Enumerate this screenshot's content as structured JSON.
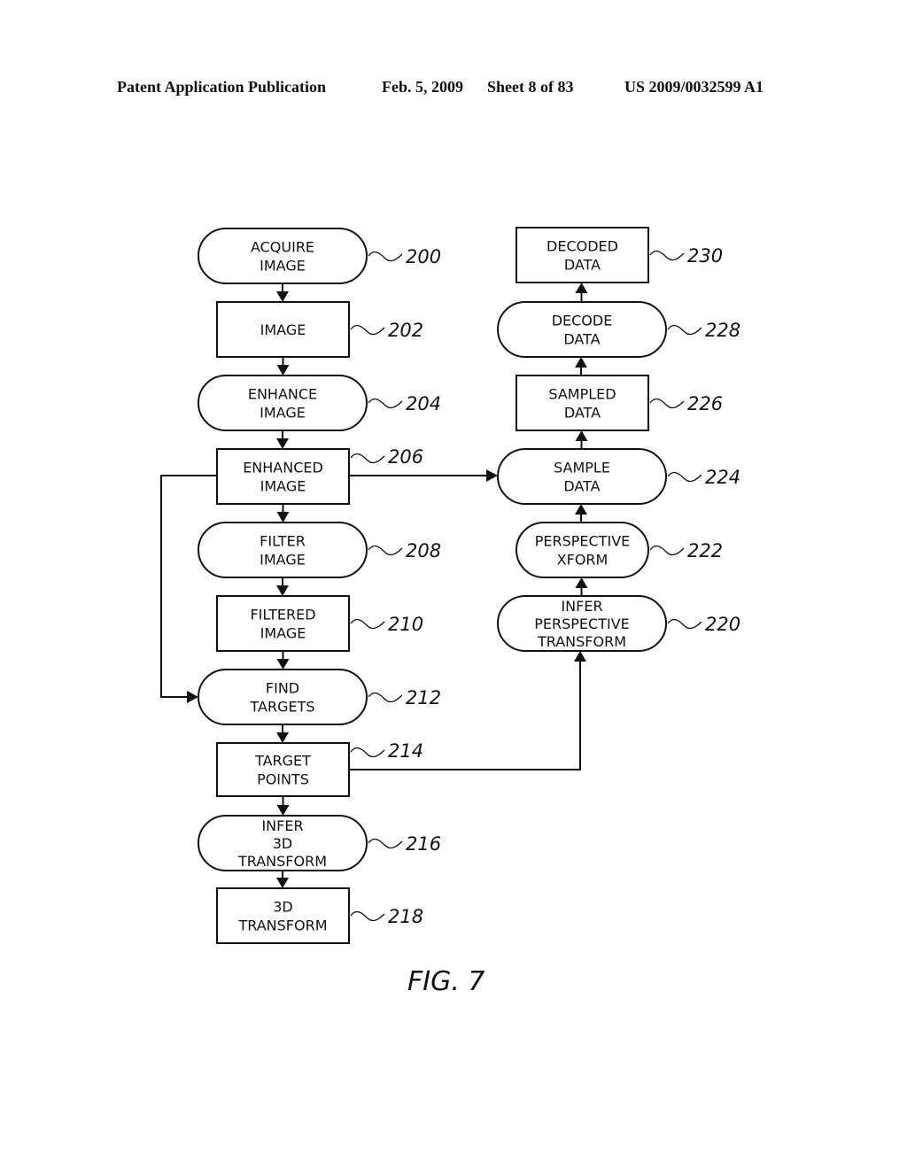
{
  "header": {
    "publication": "Patent Application Publication",
    "date": "Feb. 5, 2009",
    "sheet": "Sheet 8 of 83",
    "number": "US 2009/0032599 A1"
  },
  "figure": {
    "label": "FIG. 7",
    "nodes": [
      {
        "id": "200",
        "ref": "200",
        "shape": "rounded",
        "lines": [
          "ACQUIRE",
          "IMAGE"
        ]
      },
      {
        "id": "202",
        "ref": "202",
        "shape": "rect",
        "lines": [
          "IMAGE"
        ]
      },
      {
        "id": "204",
        "ref": "204",
        "shape": "rounded",
        "lines": [
          "ENHANCE",
          "IMAGE"
        ]
      },
      {
        "id": "206",
        "ref": "206",
        "shape": "rect",
        "lines": [
          "ENHANCED",
          "IMAGE"
        ]
      },
      {
        "id": "208",
        "ref": "208",
        "shape": "rounded",
        "lines": [
          "FILTER",
          "IMAGE"
        ]
      },
      {
        "id": "210",
        "ref": "210",
        "shape": "rect",
        "lines": [
          "FILTERED",
          "IMAGE"
        ]
      },
      {
        "id": "212",
        "ref": "212",
        "shape": "rounded",
        "lines": [
          "FIND",
          "TARGETS"
        ]
      },
      {
        "id": "214",
        "ref": "214",
        "shape": "rect",
        "lines": [
          "TARGET",
          "POINTS"
        ]
      },
      {
        "id": "216",
        "ref": "216",
        "shape": "rounded",
        "lines": [
          "INFER",
          "3D",
          "TRANSFORM"
        ]
      },
      {
        "id": "218",
        "ref": "218",
        "shape": "rect",
        "lines": [
          "3D",
          "TRANSFORM"
        ]
      },
      {
        "id": "220",
        "ref": "220",
        "shape": "rounded",
        "lines": [
          "INFER",
          "PERSPECTIVE",
          "TRANSFORM"
        ]
      },
      {
        "id": "222",
        "ref": "222",
        "shape": "rounded",
        "lines": [
          "PERSPECTIVE",
          "XFORM"
        ]
      },
      {
        "id": "224",
        "ref": "224",
        "shape": "rounded",
        "lines": [
          "SAMPLE",
          "DATA"
        ]
      },
      {
        "id": "226",
        "ref": "226",
        "shape": "rect",
        "lines": [
          "SAMPLED",
          "DATA"
        ]
      },
      {
        "id": "228",
        "ref": "228",
        "shape": "rounded",
        "lines": [
          "DECODE",
          "DATA"
        ]
      },
      {
        "id": "230",
        "ref": "230",
        "shape": "rect",
        "lines": [
          "DECODED",
          "DATA"
        ]
      }
    ],
    "edges": [
      {
        "from": "200",
        "to": "202"
      },
      {
        "from": "202",
        "to": "204"
      },
      {
        "from": "204",
        "to": "206"
      },
      {
        "from": "206",
        "to": "208"
      },
      {
        "from": "208",
        "to": "210"
      },
      {
        "from": "210",
        "to": "212"
      },
      {
        "from": "206",
        "to": "212"
      },
      {
        "from": "212",
        "to": "214"
      },
      {
        "from": "214",
        "to": "216"
      },
      {
        "from": "216",
        "to": "218"
      },
      {
        "from": "214",
        "to": "220"
      },
      {
        "from": "220",
        "to": "222"
      },
      {
        "from": "222",
        "to": "224"
      },
      {
        "from": "206",
        "to": "224"
      },
      {
        "from": "224",
        "to": "226"
      },
      {
        "from": "226",
        "to": "228"
      },
      {
        "from": "228",
        "to": "230"
      }
    ]
  }
}
